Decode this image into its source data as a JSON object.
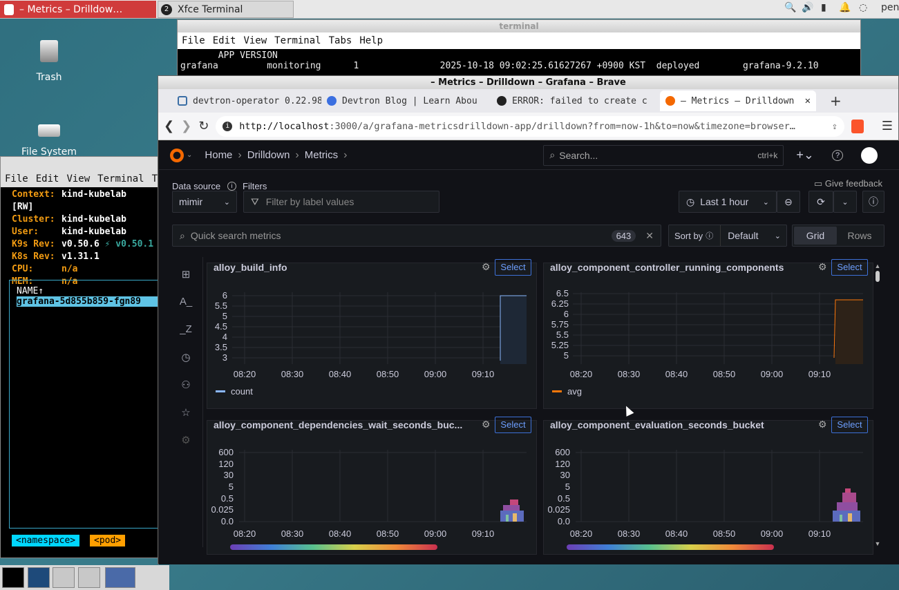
{
  "top_panel": {
    "task1": "– Metrics – Drilldow…",
    "task2": "Xfce Terminal",
    "task2_badge": "2",
    "user": "pen"
  },
  "desktop": {
    "trash": "Trash",
    "filesystem": "File System"
  },
  "terminal_back": {
    "title": "terminal",
    "menu": [
      "File",
      "Edit",
      "View",
      "Terminal",
      "Tabs",
      "Help"
    ],
    "line1": "       APP VERSION",
    "line2": "grafana         monitoring      1               2025-10-18 09:02:25.61627267 +0900 KST  deployed        grafana-9.2.10"
  },
  "k9s": {
    "menu": [
      "File",
      "Edit",
      "View",
      "Terminal",
      "Ta"
    ],
    "info": [
      {
        "k": "Context:",
        "v": "kind-kubelab [RW]"
      },
      {
        "k": "Cluster:",
        "v": "kind-kubelab"
      },
      {
        "k": "User:",
        "v": "kind-kubelab"
      },
      {
        "k": "K9s Rev:",
        "v": "v0.50.6",
        "v2": "⚡ v0.50.1"
      },
      {
        "k": "K8s Rev:",
        "v": "v1.31.1"
      },
      {
        "k": "CPU:",
        "v": "n/a"
      },
      {
        "k": "MEM:",
        "v": "n/a"
      }
    ],
    "col_header": "NAME↑",
    "pod": "grafana-5d855b859-fgn89",
    "crumb1": "<namespace>",
    "crumb2": "<pod>"
  },
  "browser": {
    "window_title": "– Metrics – Drilldown – Grafana – Brave",
    "tabs": [
      "devtron-operator 0.22.98",
      "Devtron Blog | Learn Abou",
      "ERROR: failed to create c",
      "– Metrics – Drilldown"
    ],
    "url_host": "http://localhost",
    "url_rest": ":3000/a/grafana-metricsdrilldown-app/drilldown?from=now-1h&to=now&timezone=browser…"
  },
  "grafana": {
    "breadcrumbs": [
      "Home",
      "Drilldown",
      "Metrics"
    ],
    "search_placeholder": "Search...",
    "search_shortcut": "ctrl+k",
    "datasource_label": "Data source",
    "filters_label": "Filters",
    "datasource_value": "mimir",
    "filter_placeholder": "Filter by label values",
    "give_feedback": "Give feedback",
    "time_range": "Last 1 hour",
    "quick_search_placeholder": "Quick search metrics",
    "metric_count": "643",
    "sort_by_label": "Sort by",
    "sort_value": "Default",
    "view_grid": "Grid",
    "view_rows": "Rows",
    "select_label": "Select",
    "panels": [
      {
        "title": "alloy_build_info",
        "legend": "count",
        "legend_color": "#8ab8ff",
        "yticks": [
          "6",
          "5.5",
          "5",
          "4.5",
          "4",
          "3.5",
          "3"
        ],
        "xticks": [
          "08:20",
          "08:30",
          "08:40",
          "08:50",
          "09:00",
          "09:10"
        ]
      },
      {
        "title": "alloy_component_controller_running_components",
        "legend": "avg",
        "legend_color": "#ff780a",
        "yticks": [
          "6.5",
          "6.25",
          "6",
          "5.75",
          "5.5",
          "5.25",
          "5"
        ],
        "xticks": [
          "08:20",
          "08:30",
          "08:40",
          "08:50",
          "09:00",
          "09:10"
        ]
      },
      {
        "title": "alloy_component_dependencies_wait_seconds_buc...",
        "yticks": [
          "600",
          "120",
          "30",
          "5",
          "0.5",
          "0.025",
          "0.0"
        ],
        "xticks": [
          "08:20",
          "08:30",
          "08:40",
          "08:50",
          "09:00",
          "09:10"
        ]
      },
      {
        "title": "alloy_component_evaluation_seconds_bucket",
        "yticks": [
          "600",
          "120",
          "30",
          "5",
          "0.5",
          "0.025",
          "0.0"
        ],
        "xticks": [
          "08:20",
          "08:30",
          "08:40",
          "08:50",
          "09:00",
          "09:10"
        ]
      }
    ]
  }
}
